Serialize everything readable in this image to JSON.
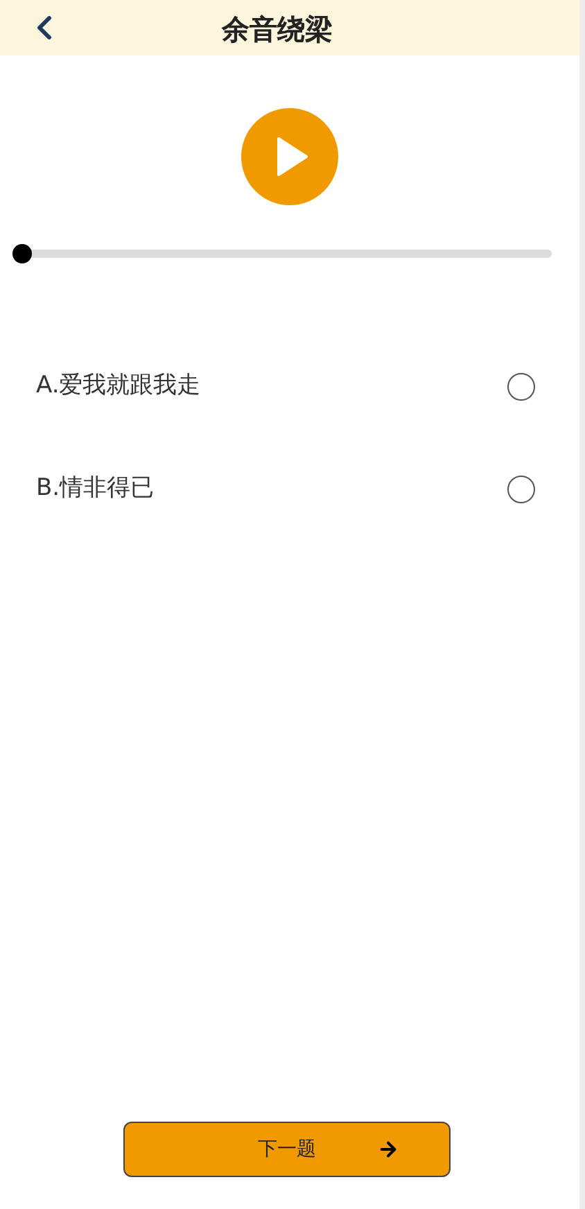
{
  "header": {
    "title": "余音绕梁"
  },
  "player": {
    "playing": false,
    "progress": {
      "level": 0
    }
  },
  "options": [
    {
      "label": "A.爱我就跟我走",
      "selected": false
    },
    {
      "label": "B.情非得已",
      "selected": false
    }
  ],
  "next_button": {
    "label": "下一题"
  }
}
